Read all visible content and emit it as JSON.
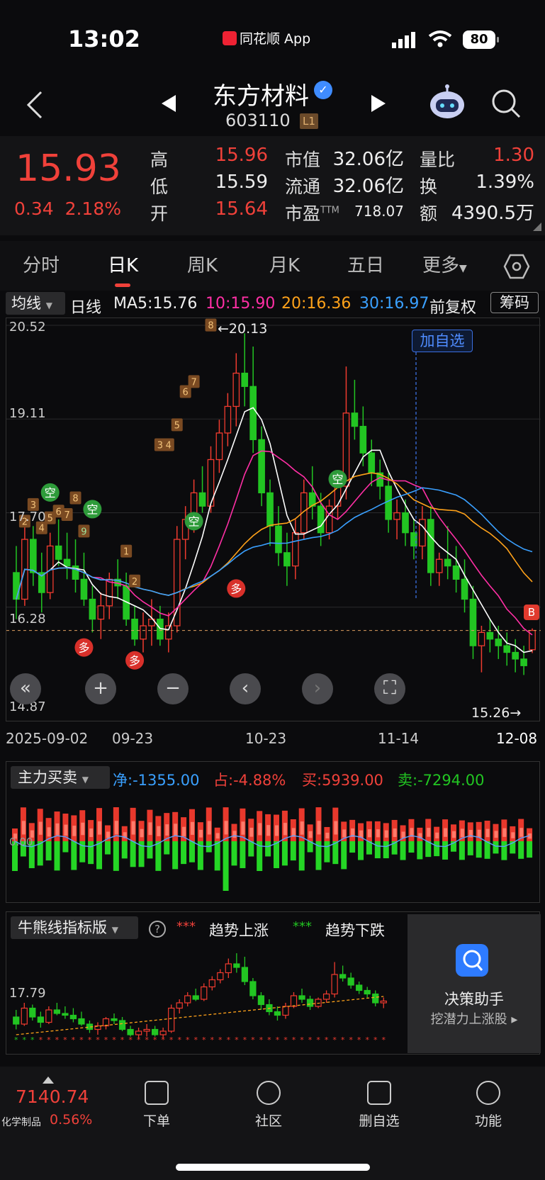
{
  "status": {
    "time": "13:02",
    "app": "同花顺 App",
    "battery": "80"
  },
  "header": {
    "name": "东方材料",
    "code": "603110",
    "level": "L1"
  },
  "quote": {
    "price": "15.93",
    "change": "0.34",
    "change_pct": "2.18%",
    "high_label": "高",
    "high": "15.96",
    "low_label": "低",
    "low": "15.59",
    "open_label": "开",
    "open": "15.64",
    "mktcap_label": "市值",
    "mktcap": "32.06亿",
    "float_label": "流通",
    "float": "32.06亿",
    "pe_label": "市盈",
    "pe_sup": "TTM",
    "pe": "718.07",
    "volratio_label": "量比",
    "volratio": "1.30",
    "turnover_label": "换",
    "turnover": "1.39%",
    "amount_label": "额",
    "amount": "4390.5万"
  },
  "tabs": [
    "分时",
    "日K",
    "周K",
    "月K",
    "五日",
    "更多"
  ],
  "ma": {
    "select": "均线",
    "period": "日线",
    "ma5": "MA5:15.76",
    "ma10": "10:15.90",
    "ma20": "20:16.36",
    "ma30": "30:16.97",
    "adjust": "前复权",
    "chips": "筹码"
  },
  "kline": {
    "y_labels": [
      "20.52",
      "19.11",
      "17.70",
      "16.28",
      "14.87"
    ],
    "max_label": "←20.13",
    "min_label": "15.26→",
    "add_watch": "加自选",
    "signals": {
      "kong": "空",
      "duo": "多",
      "buy": "B"
    },
    "seq": [
      "2",
      "3",
      "4",
      "5",
      "6",
      "7",
      "8",
      "9",
      "1",
      "2",
      "3",
      "4",
      "5",
      "6",
      "7",
      "8"
    ]
  },
  "dates": [
    "2025-09-02",
    "09-23",
    "10-23",
    "11-14",
    "12-08"
  ],
  "flow": {
    "title": "主力买卖",
    "net": "净:-1355.00",
    "pct": "占:-4.88%",
    "buy": "买:5939.00",
    "sell": "卖:-7294.00",
    "axis": "0.00"
  },
  "bull": {
    "title": "牛熊线指标版",
    "help": "?",
    "up": "趋势上涨",
    "down": "趋势下跌",
    "axis": "17.79",
    "ad_title": "决策助手",
    "ad_sub": "挖潜力上涨股 ▸"
  },
  "bottom": {
    "index_value": "7140.74",
    "index_name": "化学制品",
    "index_pct": "0.56%",
    "items": [
      "下单",
      "社区",
      "删自选",
      "功能"
    ]
  },
  "chart_data": {
    "type": "candlestick",
    "title": "",
    "ylim": [
      14.87,
      20.52
    ],
    "x_ticks": [
      "2025-09-02",
      "09-23",
      "10-23",
      "11-14",
      "12-08"
    ],
    "last": {
      "open": 15.64,
      "high": 15.96,
      "low": 15.59,
      "close": 15.93
    },
    "series": [
      {
        "name": "MA5",
        "last": 15.76,
        "color": "#ffffff"
      },
      {
        "name": "10",
        "last": 15.9,
        "color": "#ff2fa5"
      },
      {
        "name": "20",
        "last": 16.36,
        "color": "#ffa21a"
      },
      {
        "name": "30",
        "last": 16.97,
        "color": "#3aa0ff"
      }
    ],
    "candles": [
      [
        16.8,
        17.2,
        16.1,
        16.4
      ],
      [
        16.4,
        17.6,
        16.3,
        17.3
      ],
      [
        17.3,
        17.5,
        16.6,
        16.8
      ],
      [
        16.8,
        17.1,
        16.2,
        16.5
      ],
      [
        16.5,
        17.4,
        16.4,
        17.2
      ],
      [
        17.2,
        17.6,
        16.9,
        17.0
      ],
      [
        17.0,
        17.4,
        16.7,
        16.9
      ],
      [
        16.9,
        17.3,
        16.5,
        16.7
      ],
      [
        16.7,
        17.1,
        16.3,
        16.4
      ],
      [
        16.4,
        16.6,
        15.9,
        16.1
      ],
      [
        16.1,
        16.5,
        15.8,
        16.3
      ],
      [
        16.3,
        16.8,
        16.1,
        16.7
      ],
      [
        16.7,
        17.0,
        16.4,
        16.6
      ],
      [
        16.6,
        16.8,
        16.0,
        16.1
      ],
      [
        16.1,
        16.3,
        15.7,
        15.8
      ],
      [
        15.8,
        16.2,
        15.6,
        16.0
      ],
      [
        16.0,
        16.4,
        15.7,
        16.1
      ],
      [
        16.1,
        16.3,
        15.7,
        15.8
      ],
      [
        15.8,
        16.2,
        15.6,
        16.0
      ],
      [
        16.0,
        17.5,
        15.9,
        17.3
      ],
      [
        17.3,
        17.8,
        17.0,
        17.6
      ],
      [
        17.6,
        18.2,
        17.4,
        18.0
      ],
      [
        18.0,
        18.4,
        17.7,
        17.8
      ],
      [
        17.8,
        18.7,
        17.7,
        18.5
      ],
      [
        18.5,
        19.1,
        18.3,
        18.9
      ],
      [
        18.9,
        19.5,
        18.7,
        19.3
      ],
      [
        19.3,
        20.1,
        19.0,
        19.8
      ],
      [
        19.8,
        20.4,
        19.3,
        19.6
      ],
      [
        19.6,
        20.2,
        18.6,
        18.8
      ],
      [
        18.8,
        19.0,
        17.8,
        18.0
      ],
      [
        18.0,
        18.2,
        17.2,
        17.5
      ],
      [
        17.5,
        17.8,
        16.9,
        17.1
      ],
      [
        17.1,
        17.4,
        16.6,
        16.9
      ],
      [
        16.9,
        17.6,
        16.7,
        17.4
      ],
      [
        17.4,
        18.2,
        17.3,
        18.0
      ],
      [
        18.0,
        18.4,
        17.6,
        17.8
      ],
      [
        17.8,
        18.0,
        17.2,
        17.4
      ],
      [
        17.4,
        17.9,
        17.3,
        17.8
      ],
      [
        17.8,
        18.3,
        17.6,
        18.1
      ],
      [
        18.1,
        19.9,
        17.9,
        19.2
      ],
      [
        19.2,
        19.7,
        18.8,
        19.0
      ],
      [
        19.0,
        19.3,
        18.4,
        18.6
      ],
      [
        18.6,
        18.8,
        18.1,
        18.3
      ],
      [
        18.3,
        18.5,
        17.9,
        18.1
      ],
      [
        18.1,
        18.3,
        17.4,
        17.6
      ],
      [
        17.6,
        17.9,
        17.3,
        17.7
      ],
      [
        17.7,
        17.9,
        17.2,
        17.4
      ],
      [
        17.4,
        17.6,
        17.0,
        17.2
      ],
      [
        17.2,
        17.8,
        17.0,
        17.6
      ],
      [
        17.6,
        17.8,
        16.6,
        16.8
      ],
      [
        16.8,
        17.1,
        16.6,
        17.0
      ],
      [
        17.0,
        17.5,
        16.7,
        16.9
      ],
      [
        16.9,
        17.2,
        16.5,
        16.7
      ],
      [
        16.7,
        17.0,
        16.2,
        16.4
      ],
      [
        16.4,
        16.6,
        15.5,
        15.7
      ],
      [
        15.7,
        16.0,
        15.3,
        15.9
      ],
      [
        15.9,
        16.1,
        15.6,
        15.8
      ],
      [
        15.8,
        16.0,
        15.5,
        15.7
      ],
      [
        15.7,
        15.9,
        15.4,
        15.6
      ],
      [
        15.6,
        15.8,
        15.3,
        15.5
      ],
      [
        15.5,
        15.7,
        15.26,
        15.4
      ],
      [
        15.64,
        15.96,
        15.59,
        15.93
      ]
    ]
  }
}
